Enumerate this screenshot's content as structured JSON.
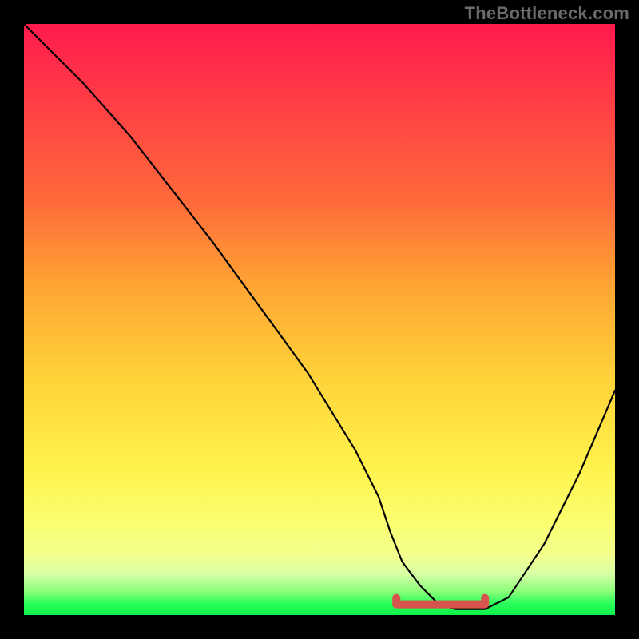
{
  "watermark": "TheBottleneck.com",
  "colors": {
    "frame": "#000000",
    "marker": "#d6534e",
    "curve": "#000000",
    "gradient_stops": [
      "#ff1a4d",
      "#ff3a46",
      "#ff6a3a",
      "#ffa733",
      "#ffd33a",
      "#fff04a",
      "#fbff6e",
      "#f3ff8e",
      "#d8ffa6",
      "#8cff7a",
      "#2cff5c",
      "#0cf04a"
    ]
  },
  "chart_data": {
    "type": "line",
    "title": "",
    "xlabel": "",
    "ylabel": "",
    "xlim": [
      0,
      100
    ],
    "ylim": [
      0,
      100
    ],
    "legend": false,
    "grid": false,
    "series": [
      {
        "name": "bottleneck-curve",
        "x": [
          0,
          4,
          10,
          18,
          25,
          32,
          40,
          48,
          56,
          60,
          62,
          64,
          67,
          70,
          73,
          76,
          78,
          82,
          88,
          94,
          100
        ],
        "y": [
          100,
          96,
          90,
          81,
          72,
          63,
          52,
          41,
          28,
          20,
          14,
          9,
          5,
          2,
          1,
          1,
          1,
          3,
          12,
          24,
          38
        ]
      }
    ],
    "highlight": {
      "name": "optimal-range-marker",
      "x": [
        63,
        78
      ],
      "y": [
        1,
        1
      ]
    }
  }
}
